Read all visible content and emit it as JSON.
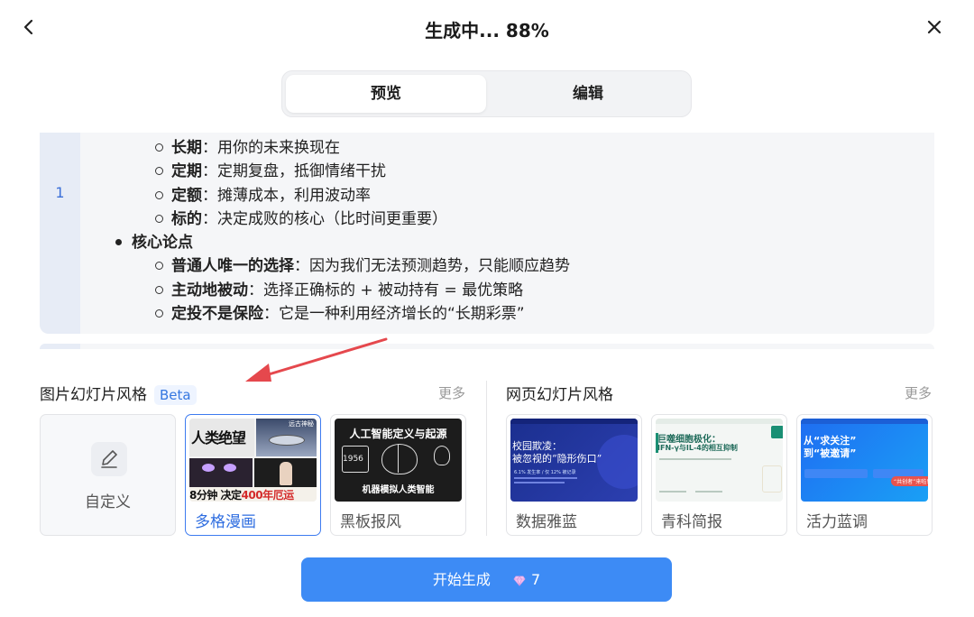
{
  "header": {
    "title": "生成中... 88%"
  },
  "tabs": [
    {
      "label": "预览",
      "active": true
    },
    {
      "label": "编辑",
      "active": false
    }
  ],
  "preview": {
    "slide_number": "1",
    "lines": [
      {
        "level": 2,
        "bold": "长期",
        "rest": "：用你的未来换现在"
      },
      {
        "level": 2,
        "bold": "定期",
        "rest": "：定期复盘，抵御情绪干扰"
      },
      {
        "level": 2,
        "bold": "定额",
        "rest": "：摊薄成本，利用波动率"
      },
      {
        "level": 2,
        "bold": "标的",
        "rest": "：决定成败的核心（比时间更重要）"
      },
      {
        "level": 1,
        "bold": "核心论点",
        "rest": ""
      },
      {
        "level": 2,
        "bold": "普通人唯一的选择",
        "rest": "：因为我们无法预测趋势，只能顺应趋势"
      },
      {
        "level": 2,
        "bold": "主动地被动",
        "rest": "：选择正确标的 + 被动持有 = 最优策略"
      },
      {
        "level": 2,
        "bold": "定投不是保险",
        "rest": "：它是一种利用经济增长的“长期彩票”"
      }
    ]
  },
  "image_styles": {
    "title": "图片幻灯片风格",
    "badge": "Beta",
    "more": "更多",
    "cards": [
      {
        "label": "自定义",
        "icon": "edit-icon"
      },
      {
        "label": "多格漫画",
        "selected": true,
        "thumb_text": {
          "top": "人类绝望",
          "bottom_a": "8分钟 决定",
          "bottom_b": "400年厄运",
          "corner": "远古神秘"
        }
      },
      {
        "label": "黑板报风",
        "thumb_text": {
          "title": "人工智能定义与起源",
          "year": "1956",
          "bottom": "机器模拟人类智能"
        }
      }
    ]
  },
  "web_styles": {
    "title": "网页幻灯片风格",
    "more": "更多",
    "cards": [
      {
        "label": "数据雅蓝",
        "thumb_text": {
          "title_a": "校园欺凌：",
          "title_b": "被忽视的“隐形伤口”",
          "stats": "6.1% 发生率  /  仅 12% 被记录"
        }
      },
      {
        "label": "青科简报",
        "thumb_text": {
          "title_a": "巨噬细胞极化：",
          "title_b": "IFN-γ与IL-4的相互抑制"
        }
      },
      {
        "label": "活力蓝调",
        "thumb_text": {
          "title_a": "从“求关注”",
          "title_b": "到“被邀请”",
          "button": "“共创者”来啦！"
        }
      }
    ]
  },
  "generate": {
    "label": "开始生成",
    "cost": "7",
    "cost_icon": "gem-icon"
  },
  "colors": {
    "accent": "#3d8bf5",
    "selected_border": "#3d7bf0",
    "arrow": "#e5484d"
  }
}
